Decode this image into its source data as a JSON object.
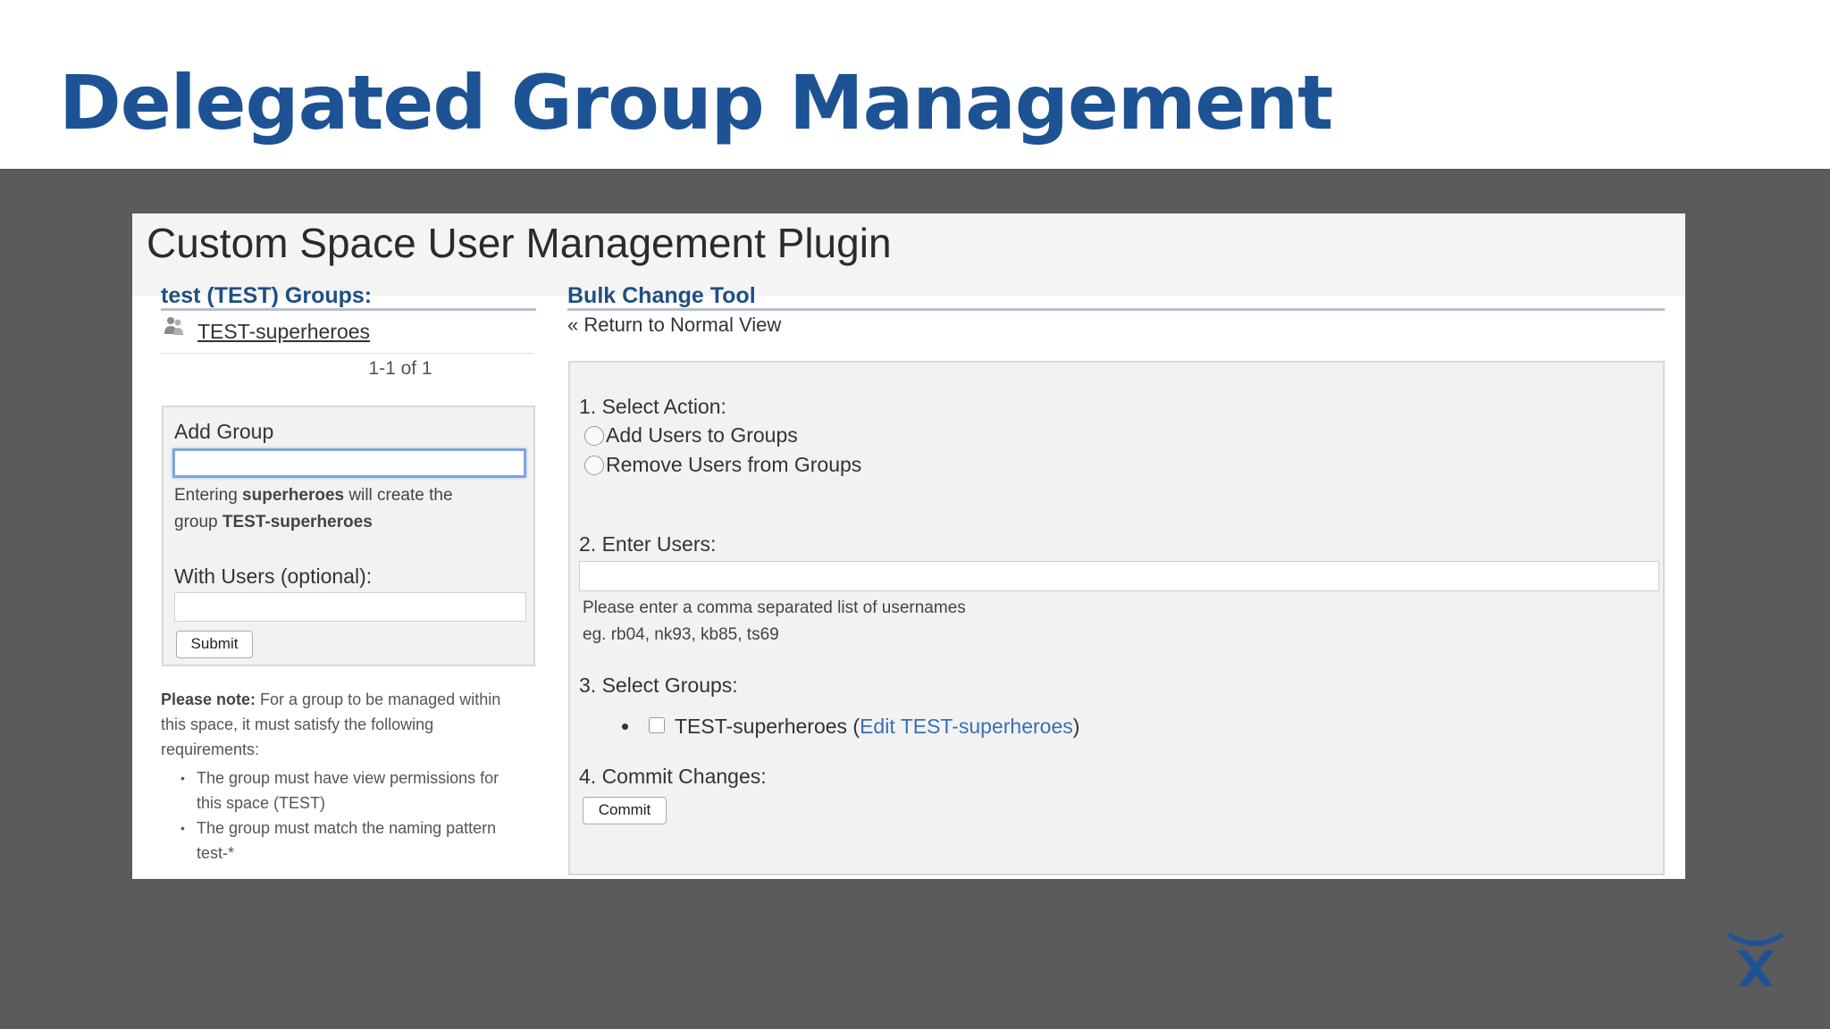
{
  "slide": {
    "title": "Delegated Group Management"
  },
  "plugin": {
    "title": "Custom Space User Management Plugin"
  },
  "groups_panel": {
    "heading": "test (TEST) Groups:",
    "group_link": "TEST-superheroes",
    "pager": "1-1 of 1",
    "add_group": {
      "label": "Add Group",
      "input_value": "",
      "hint_prefix": "Entering ",
      "hint_keyword": "superheroes",
      "hint_middle": " will create the",
      "hint_line2_prefix": "group ",
      "hint_group": "TEST-superheroes",
      "users_label": "With Users (optional):",
      "users_value": "",
      "submit_label": "Submit"
    },
    "note": {
      "bold": "Please note:",
      "line1": " For a group to be managed within",
      "line2": "this space, it must satisfy the following",
      "line3": "requirements:",
      "item1_line1": "The group must have view permissions for",
      "item1_line2": "this space (TEST)",
      "item2_line1": "The group must match the naming pattern",
      "item2_line2": "test-*"
    }
  },
  "bulk_tool": {
    "heading": "Bulk Change Tool",
    "return_link": "« Return to Normal View",
    "step1_label": "1. Select Action:",
    "action_add": "Add Users to Groups",
    "action_remove": "Remove Users from Groups",
    "step2_label": "2. Enter Users:",
    "users_value": "",
    "users_hint1": "Please enter a comma separated list of usernames",
    "users_hint2": "eg. rb04, nk93, kb85, ts69",
    "step3_label": "3. Select Groups:",
    "group_name": "TEST-superheroes",
    "group_edit_open": "(",
    "group_edit_link": "Edit TEST-superheroes",
    "group_edit_close": ")",
    "step4_label": "4. Commit Changes:",
    "commit_label": "Commit"
  },
  "colors": {
    "slide_title": "#1d5394",
    "slide_background": "#5b5a5d",
    "section_heading": "#1f4f82",
    "link": "#3a6fb5"
  },
  "icons": {
    "group": "group-icon",
    "brand": "atlassian-logo-icon"
  }
}
